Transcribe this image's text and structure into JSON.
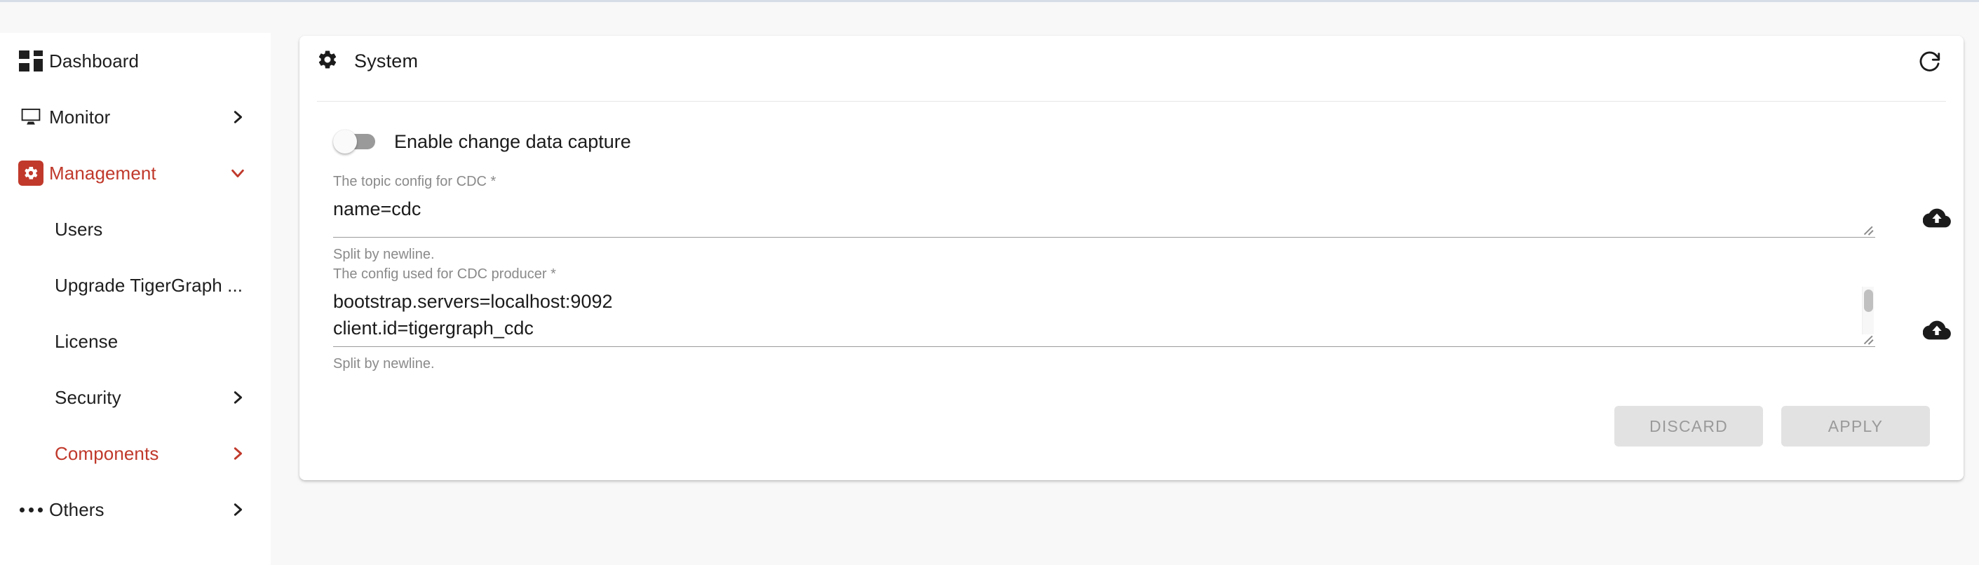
{
  "sidebar": {
    "items": [
      {
        "label": "Dashboard",
        "icon": "dashboard-icon",
        "chevron": "none",
        "level": "top",
        "active": false
      },
      {
        "label": "Monitor",
        "icon": "monitor-icon",
        "chevron": "right",
        "level": "top",
        "active": false
      },
      {
        "label": "Management",
        "icon": "management-gear-icon",
        "chevron": "down",
        "level": "top",
        "active": true
      },
      {
        "label": "Users",
        "icon": "none",
        "chevron": "none",
        "level": "sub",
        "active": false
      },
      {
        "label": "Upgrade TigerGraph ...",
        "icon": "none",
        "chevron": "none",
        "level": "sub",
        "active": false
      },
      {
        "label": "License",
        "icon": "none",
        "chevron": "none",
        "level": "sub",
        "active": false
      },
      {
        "label": "Security",
        "icon": "none",
        "chevron": "right",
        "level": "sub",
        "active": false
      },
      {
        "label": "Components",
        "icon": "none",
        "chevron": "right",
        "level": "sub",
        "active": true
      },
      {
        "label": "Others",
        "icon": "ellipsis-icon",
        "chevron": "right",
        "level": "top",
        "active": false
      }
    ]
  },
  "card": {
    "title": "System",
    "title_icon": "gear-icon",
    "refresh_icon": "refresh-icon",
    "toggle": {
      "label": "Enable change data capture",
      "state": "off"
    },
    "fields": [
      {
        "label": "The topic config for CDC *",
        "value": "name=cdc",
        "hint": "Split by newline.",
        "upload_icon": "cloud-upload-icon",
        "has_scrollbar": false
      },
      {
        "label": "The config used for CDC producer *",
        "value": "bootstrap.servers=localhost:9092\nclient.id=tigergraph_cdc",
        "hint": "Split by newline.",
        "upload_icon": "cloud-upload-icon",
        "has_scrollbar": true
      }
    ],
    "actions": {
      "discard_label": "DISCARD",
      "apply_label": "APPLY"
    }
  },
  "colors": {
    "accent": "#c0392b",
    "page_bg": "#f8f8f8",
    "card_bg": "#ffffff",
    "muted_text": "#8a8a8a",
    "button_bg": "#e2e2e2",
    "button_text": "#9a9a9a"
  }
}
